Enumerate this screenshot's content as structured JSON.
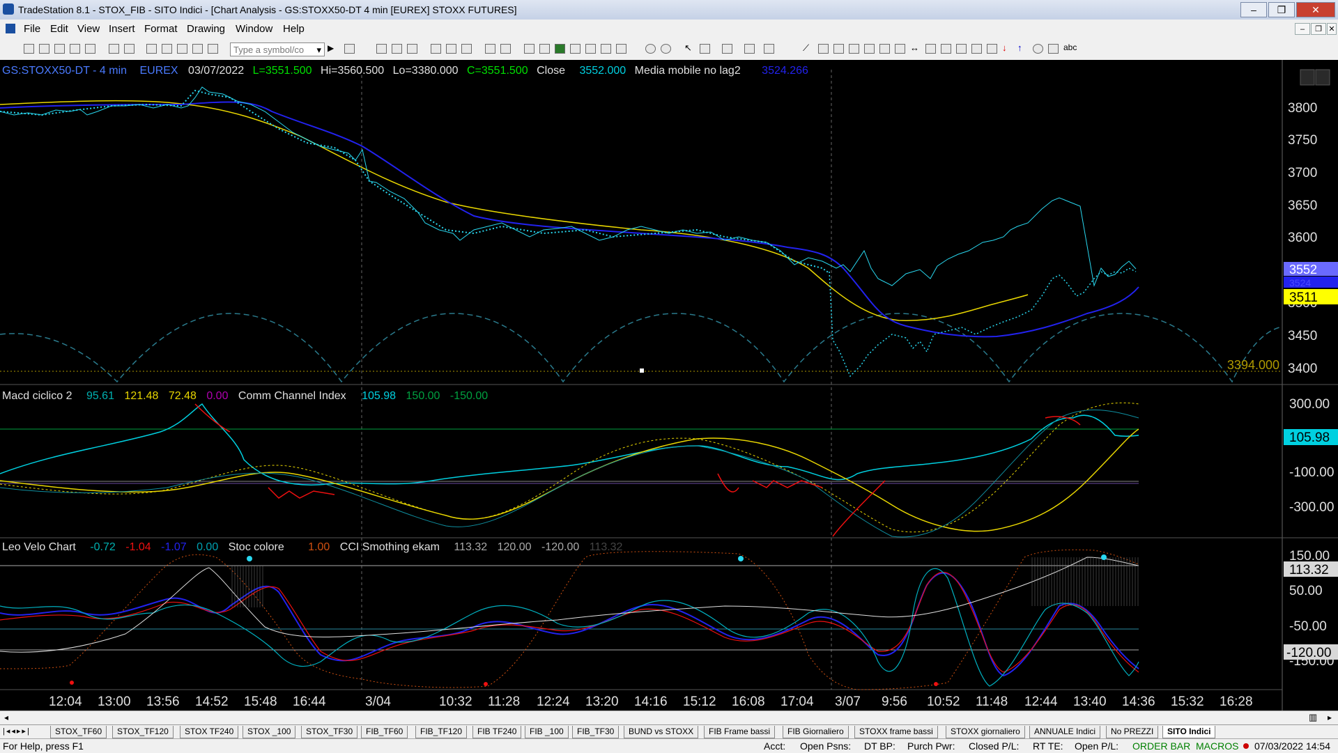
{
  "window": {
    "title": "TradeStation 8.1 - STOX_FIB - SITO Indici - [Chart Analysis - GS:STOXX50-DT  4 min  [EUREX] STOXX FUTURES]"
  },
  "menu": [
    "File",
    "Edit",
    "View",
    "Insert",
    "Format",
    "Drawing",
    "Window",
    "Help"
  ],
  "toolbar": {
    "symbol_placeholder": "Type a symbol/co",
    "text_tool_label": "abc"
  },
  "chart": {
    "symbol": "GS:STOXX50-DT - 4 min",
    "exchange": "EUREX",
    "date": "03/07/2022",
    "last": "L=3551.500",
    "high": "Hi=3560.500",
    "low": "Lo=3380.000",
    "close_c": "C=3551.500",
    "close_label": "Close",
    "close_value": "3552.000",
    "ma_label": "Media mobile no lag2",
    "ma_value": "3524.266",
    "price_axis": [
      "3800",
      "3750",
      "3700",
      "3650",
      "3600",
      "3550",
      "3500",
      "3450",
      "3400"
    ],
    "price_tags": {
      "last": "3552",
      "ma": "3524",
      "yellow": "3511",
      "dotted": "3394.000"
    },
    "macd": {
      "name": "Macd ciclico 2",
      "v1": "95.61",
      "v2": "121.48",
      "v3": "72.48",
      "v4": "0.00",
      "cci_name": "Comm Channel Index",
      "cci": "105.98",
      "upper": "150.00",
      "lower": "-150.00"
    },
    "macd_axis": [
      "300.00",
      "-100.00",
      "-300.00"
    ],
    "macd_tag": "105.98",
    "leo": {
      "name": "Leo Velo Chart",
      "v1": "-0.72",
      "v2": "-1.04",
      "v3": "-1.07",
      "v4": "0.00",
      "stoc": "Stoc colore",
      "stoc_val": "1.00",
      "cci_s": "CCI Smothing ekam",
      "c1": "113.32",
      "c2": "120.00",
      "c3": "-120.00",
      "c4": "113.32"
    },
    "leo_axis": [
      "150.00",
      "50.00",
      "-50.00",
      "-150.00"
    ],
    "leo_tags": [
      "113.32",
      "-120.00"
    ],
    "time_axis": [
      "12:04",
      "13:00",
      "13:56",
      "14:52",
      "15:48",
      "16:44",
      "3/04",
      "10:32",
      "11:28",
      "12:24",
      "13:20",
      "14:16",
      "15:12",
      "16:08",
      "17:04",
      "3/07",
      "9:56",
      "10:52",
      "11:48",
      "12:44",
      "13:40",
      "14:36",
      "15:32",
      "16:28"
    ]
  },
  "tabs": [
    "STOX_TF60",
    "STOX_TF120",
    "STOX TF240",
    "STOX _100",
    "STOX_TF30",
    "FIB_TF60",
    "FIB_TF120",
    "FIB TF240",
    "FIB _100",
    "FIB_TF30",
    "BUND vs STOXX",
    "FIB Frame bassi",
    "FIB Giornaliero",
    "STOXX frame bassi",
    "STOXX giornaliero",
    "ANNUALE Indici",
    "No PREZZI",
    "SITO Indici"
  ],
  "status": {
    "help": "For Help, press F1",
    "acct": "Acct:",
    "open_psns": "Open Psns:",
    "dt_bp": "DT BP:",
    "purch": "Purch Pwr:",
    "closed_pl": "Closed P/L:",
    "rt_te": "RT TE:",
    "open_pl": "Open P/L:",
    "order_bar": "ORDER BAR",
    "macros": "MACROS",
    "datetime": "07/03/2022 14:54"
  },
  "colors": {
    "price_dots": "#29d8f0",
    "ma_blue": "#2222ee",
    "ma_yellow": "#e8d600",
    "cyan": "#00d0e0",
    "red": "#ee1010",
    "green_line": "#00a040"
  }
}
